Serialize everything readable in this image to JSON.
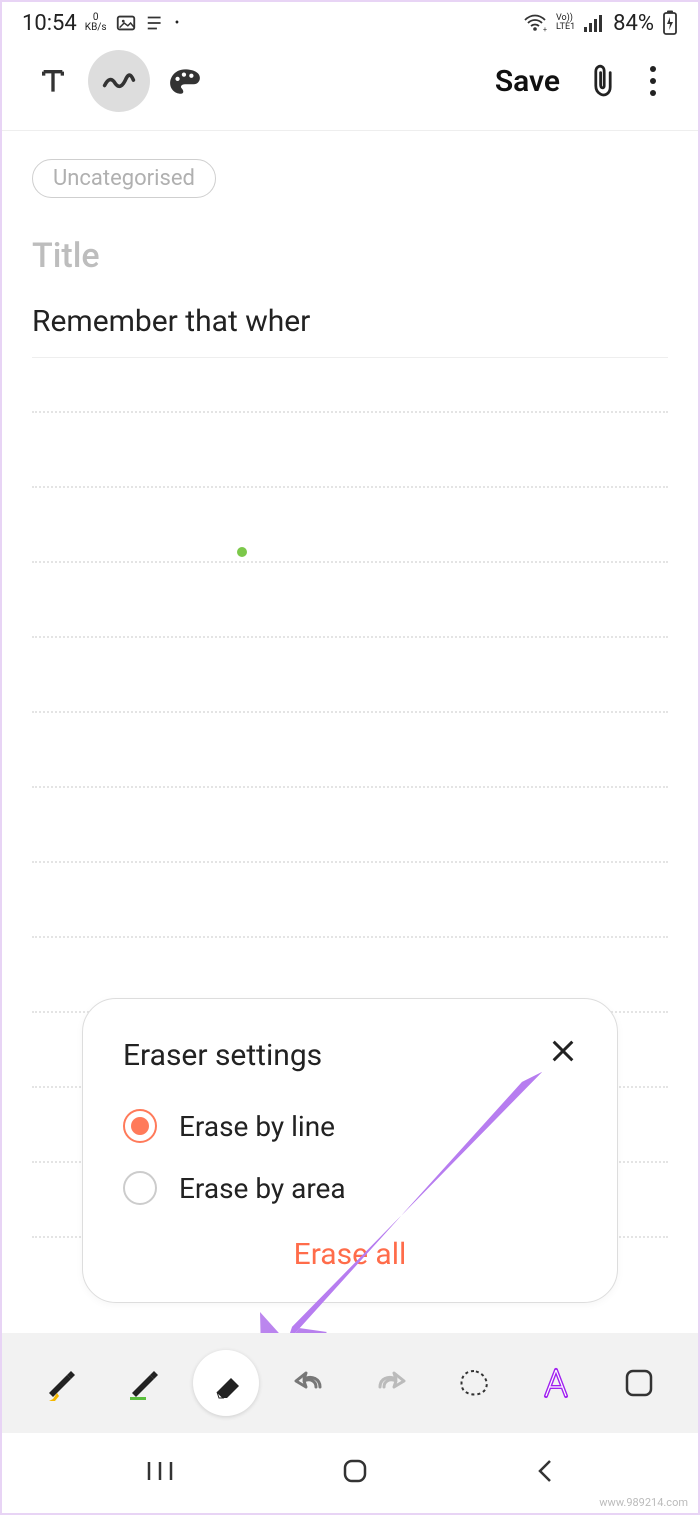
{
  "statusbar": {
    "time": "10:54",
    "speed_value": "0",
    "speed_unit": "KB/s",
    "network_label": "Vo))\nLTE1",
    "battery_text": "84%"
  },
  "topbar": {
    "save_label": "Save"
  },
  "note": {
    "category_chip": "Uncategorised",
    "title_placeholder": "Title",
    "body_text": "Remember that wher"
  },
  "popup": {
    "title": "Eraser settings",
    "option1": "Erase by line",
    "option2": "Erase by area",
    "erase_all": "Erase all"
  },
  "watermark": "www.989214.com"
}
